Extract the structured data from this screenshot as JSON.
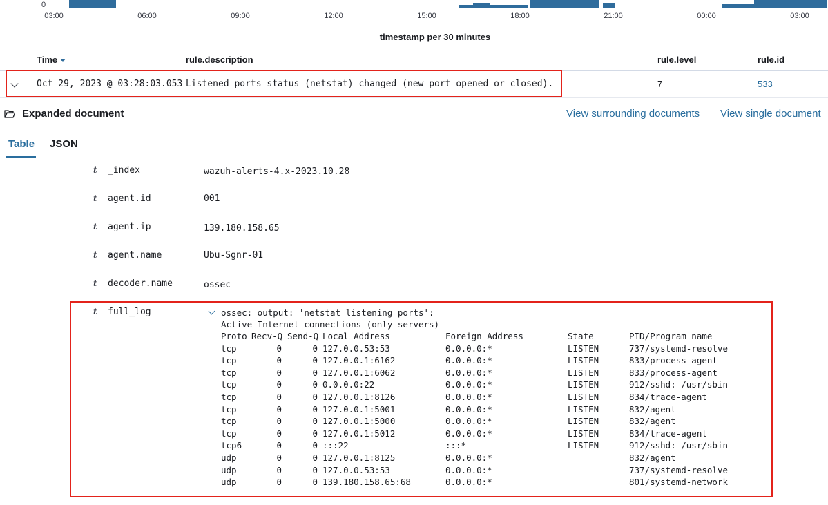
{
  "histogram": {
    "y_zero": "0",
    "x_ticks": [
      "03:00",
      "06:00",
      "09:00",
      "12:00",
      "15:00",
      "18:00",
      "21:00",
      "00:00",
      "03:00"
    ],
    "x_label": "timestamp per 30 minutes",
    "bar_color": "#2f6c9c"
  },
  "table": {
    "columns": {
      "time": "Time",
      "description": "rule.description",
      "level": "rule.level",
      "id": "rule.id"
    },
    "row": {
      "time": "Oct 29, 2023 @ 03:28:03.053",
      "description": "Listened ports status (netstat) changed (new port opened or closed).",
      "level": "7",
      "id": "533"
    }
  },
  "expanded": {
    "title": "Expanded document",
    "view_surrounding": "View surrounding documents",
    "view_single": "View single document",
    "tabs": [
      "Table",
      "JSON"
    ],
    "fields": [
      {
        "type": "t",
        "name": "_index",
        "value": "wazuh-alerts-4.x-2023.10.28",
        "link": false
      },
      {
        "type": "t",
        "name": "agent.id",
        "value": "001",
        "link": true
      },
      {
        "type": "t",
        "name": "agent.ip",
        "value": "139.180.158.65",
        "link": false
      },
      {
        "type": "t",
        "name": "agent.name",
        "value": "Ubu-Sgnr-01",
        "link": true
      },
      {
        "type": "t",
        "name": "decoder.name",
        "value": "ossec",
        "link": false
      }
    ],
    "full_log": {
      "type": "t",
      "name": "full_log",
      "line1": "ossec: output: 'netstat listening ports':",
      "line2": "Active Internet connections (only servers)",
      "header": {
        "proto": "Proto",
        "recvq": "Recv-Q",
        "sendq": "Send-Q",
        "local": "Local Address",
        "foreign": "Foreign Address",
        "state": "State",
        "pid": "PID/Program name"
      },
      "rows": [
        {
          "proto": "tcp",
          "recvq": "0",
          "sendq": "0",
          "local": "127.0.0.53:53",
          "foreign": "0.0.0.0:*",
          "state": "LISTEN",
          "pid": "737/systemd-resolve"
        },
        {
          "proto": "tcp",
          "recvq": "0",
          "sendq": "0",
          "local": "127.0.0.1:6162",
          "foreign": "0.0.0.0:*",
          "state": "LISTEN",
          "pid": "833/process-agent"
        },
        {
          "proto": "tcp",
          "recvq": "0",
          "sendq": "0",
          "local": "127.0.0.1:6062",
          "foreign": "0.0.0.0:*",
          "state": "LISTEN",
          "pid": "833/process-agent"
        },
        {
          "proto": "tcp",
          "recvq": "0",
          "sendq": "0",
          "local": "0.0.0.0:22",
          "foreign": "0.0.0.0:*",
          "state": "LISTEN",
          "pid": "912/sshd: /usr/sbin"
        },
        {
          "proto": "tcp",
          "recvq": "0",
          "sendq": "0",
          "local": "127.0.0.1:8126",
          "foreign": "0.0.0.0:*",
          "state": "LISTEN",
          "pid": "834/trace-agent"
        },
        {
          "proto": "tcp",
          "recvq": "0",
          "sendq": "0",
          "local": "127.0.0.1:5001",
          "foreign": "0.0.0.0:*",
          "state": "LISTEN",
          "pid": "832/agent"
        },
        {
          "proto": "tcp",
          "recvq": "0",
          "sendq": "0",
          "local": "127.0.0.1:5000",
          "foreign": "0.0.0.0:*",
          "state": "LISTEN",
          "pid": "832/agent"
        },
        {
          "proto": "tcp",
          "recvq": "0",
          "sendq": "0",
          "local": "127.0.0.1:5012",
          "foreign": "0.0.0.0:*",
          "state": "LISTEN",
          "pid": "834/trace-agent"
        },
        {
          "proto": "tcp6",
          "recvq": "0",
          "sendq": "0",
          "local": ":::22",
          "foreign": ":::*",
          "state": "LISTEN",
          "pid": "912/sshd: /usr/sbin"
        },
        {
          "proto": "udp",
          "recvq": "0",
          "sendq": "0",
          "local": "127.0.0.1:8125",
          "foreign": "0.0.0.0:*",
          "state": "",
          "pid": "832/agent"
        },
        {
          "proto": "udp",
          "recvq": "0",
          "sendq": "0",
          "local": "127.0.0.53:53",
          "foreign": "0.0.0.0:*",
          "state": "",
          "pid": "737/systemd-resolve"
        },
        {
          "proto": "udp",
          "recvq": "0",
          "sendq": "0",
          "local": "139.180.158.65:68",
          "foreign": "0.0.0.0:*",
          "state": "",
          "pid": "801/systemd-network"
        }
      ]
    }
  },
  "colors": {
    "link": "#2a6e9e",
    "highlight_border": "#e3231b"
  }
}
